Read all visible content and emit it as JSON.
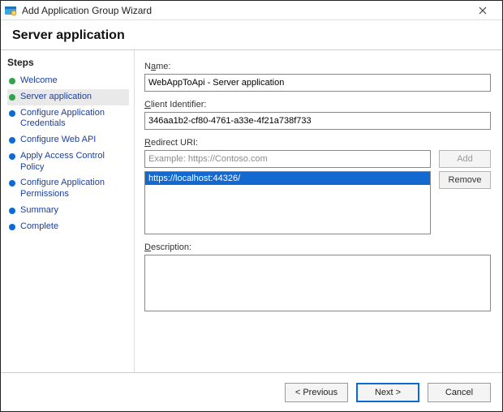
{
  "title": "Add Application Group Wizard",
  "banner": "Server application",
  "steps_header": "Steps",
  "steps": [
    {
      "label": "Welcome",
      "state": "done"
    },
    {
      "label": "Server application",
      "state": "current"
    },
    {
      "label": "Configure Application Credentials",
      "state": "todo"
    },
    {
      "label": "Configure Web API",
      "state": "todo"
    },
    {
      "label": "Apply Access Control Policy",
      "state": "todo"
    },
    {
      "label": "Configure Application Permissions",
      "state": "todo"
    },
    {
      "label": "Summary",
      "state": "todo"
    },
    {
      "label": "Complete",
      "state": "todo"
    }
  ],
  "labels": {
    "name_pre": "N",
    "name_u": "a",
    "name_post": "me:",
    "client_pre": "",
    "client_u": "C",
    "client_post": "lient Identifier:",
    "redirect_pre": "",
    "redirect_u": "R",
    "redirect_post": "edirect URI:",
    "desc_pre": "",
    "desc_u": "D",
    "desc_post": "escription:"
  },
  "fields": {
    "name": "WebAppToApi - Server application",
    "client_id": "346aa1b2-cf80-4761-a33e-4f21a738f733",
    "redirect_placeholder": "Example: https://Contoso.com",
    "redirect_value": "",
    "description": ""
  },
  "redirect_list": {
    "items": [
      {
        "text": "https://localhost:44326/",
        "selected": true
      }
    ]
  },
  "buttons": {
    "add": "Add",
    "remove_pre": "",
    "remove_u": "R",
    "remove_post": "emove",
    "prev_pre": "< ",
    "prev_u": "P",
    "prev_post": "revious",
    "next_pre": "",
    "next_u": "N",
    "next_post": "ext >",
    "cancel": "Cancel"
  }
}
